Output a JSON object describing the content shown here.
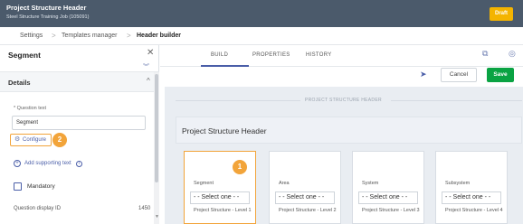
{
  "header": {
    "title": "Project Structure Header",
    "subtitle": "Steel Structure Training Job (105091)",
    "status_badge": "Draft"
  },
  "breadcrumb": {
    "items": [
      "Settings",
      "Templates manager",
      "Header builder"
    ],
    "separator": ">"
  },
  "left_panel": {
    "title": "Segment",
    "section_label": "Details",
    "question_text_label": "* Question text",
    "question_text_value": "Segment",
    "configure_label": "Configure",
    "configure_badge": "2",
    "add_supporting_text": "Add supporting text",
    "mandatory_label": "Mandatory",
    "question_display_id_label": "Question display ID",
    "question_display_id_value": "1450"
  },
  "tabs": [
    {
      "label": "BUILD",
      "active": true
    },
    {
      "label": "PROPERTIES",
      "active": false
    },
    {
      "label": "HISTORY",
      "active": false
    }
  ],
  "actions": {
    "cancel": "Cancel",
    "save": "Save"
  },
  "canvas": {
    "section_label": "PROJECT STRUCTURE HEADER",
    "header_title": "Project Structure Header",
    "selected_badge": "1",
    "cards": [
      {
        "name": "Segment",
        "select": "- - Select one - -",
        "level": "Project Structure - Level 1"
      },
      {
        "name": "Area",
        "select": "- - Select one - -",
        "level": "Project Structure - Level 2"
      },
      {
        "name": "System",
        "select": "- - Select one - -",
        "level": "Project Structure - Level 3"
      },
      {
        "name": "Subsystem",
        "select": "- - Select one - -",
        "level": "Project Structure - Level 4"
      }
    ]
  },
  "colors": {
    "topbar": "#4b5a6b",
    "draft": "#f4b400",
    "accent": "#4a5ea8",
    "highlight": "#f2a43a",
    "save": "#0aa343",
    "canvas_bg": "#e9edf2"
  },
  "icons": [
    "close-icon",
    "chevron-down-icon",
    "caret-up-icon",
    "gear-icon",
    "plus-circle-icon",
    "info-icon",
    "checkbox-icon",
    "external-link-icon",
    "globe-icon",
    "pin-icon"
  ]
}
